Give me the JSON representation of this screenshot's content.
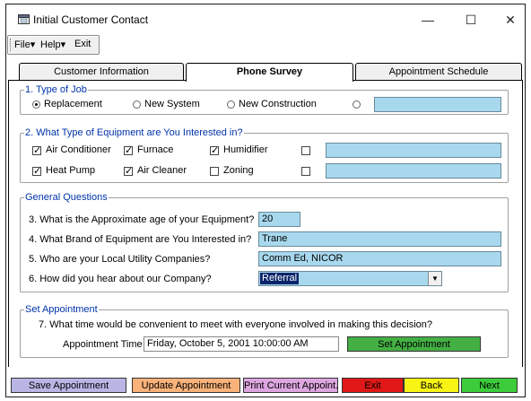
{
  "window": {
    "title": "Initial Customer Contact",
    "icon": "app-window-icon"
  },
  "window_controls": {
    "minimize": "—",
    "maximize": "☐",
    "close": "✕"
  },
  "menu": {
    "file": "File",
    "help": "Help",
    "exit": "Exit",
    "arrow": "▾"
  },
  "tabs": [
    {
      "label": "Customer Information",
      "active": false
    },
    {
      "label": "Phone Survey",
      "active": true
    },
    {
      "label": "Appointment Schedule",
      "active": false
    }
  ],
  "type_of_job": {
    "legend": "1. Type of Job",
    "options": [
      {
        "label": "Replacement",
        "selected": true
      },
      {
        "label": "New System",
        "selected": false
      },
      {
        "label": "New Construction",
        "selected": false
      },
      {
        "label": "",
        "selected": false
      }
    ],
    "other_value": ""
  },
  "equipment": {
    "legend": "2. What Type of Equipment are You Interested in?",
    "items": [
      {
        "label": "Air Conditioner",
        "checked": true
      },
      {
        "label": "Furnace",
        "checked": true
      },
      {
        "label": "Humidifier",
        "checked": true
      },
      {
        "label": "Heat Pump",
        "checked": true
      },
      {
        "label": "Air Cleaner",
        "checked": true
      },
      {
        "label": "Zoning",
        "checked": false
      }
    ],
    "other1_value": "",
    "other2_value": ""
  },
  "general": {
    "legend": "General Questions",
    "q3": {
      "label": "3. What is the Approximate age of your Equipment?",
      "value": "20"
    },
    "q4": {
      "label": "4. What Brand of Equipment are You Interested in?",
      "value": "Trane"
    },
    "q5": {
      "label": "5. Who are your Local Utility Companies?",
      "value": "Comm Ed, NICOR"
    },
    "q6": {
      "label": "6. How did you hear about our Company?",
      "value": "Referral",
      "arrow": "▼"
    }
  },
  "appointment": {
    "legend": "Set Appointment",
    "question": "7. What time would be convenient to meet with everyone  involved in making this decision?",
    "time_label": "Appointment Time",
    "time_value": "Friday, October 5, 2001 10:00:00 AM",
    "set_button": "Set Appointment"
  },
  "bottom_buttons": {
    "save": "Save Appointment",
    "update": "Update Appointment",
    "print": "Print Current Appoint.",
    "exit": "Exit",
    "back": "Back",
    "next": "Next"
  },
  "colors": {
    "field_bg": "#a8d8ee",
    "set_button": "#44b044",
    "save": "#b9b6e6",
    "update": "#f8b27a",
    "print": "#dda6e0",
    "exit": "#e01818",
    "back": "#f8f414",
    "next": "#3ccc3c"
  }
}
